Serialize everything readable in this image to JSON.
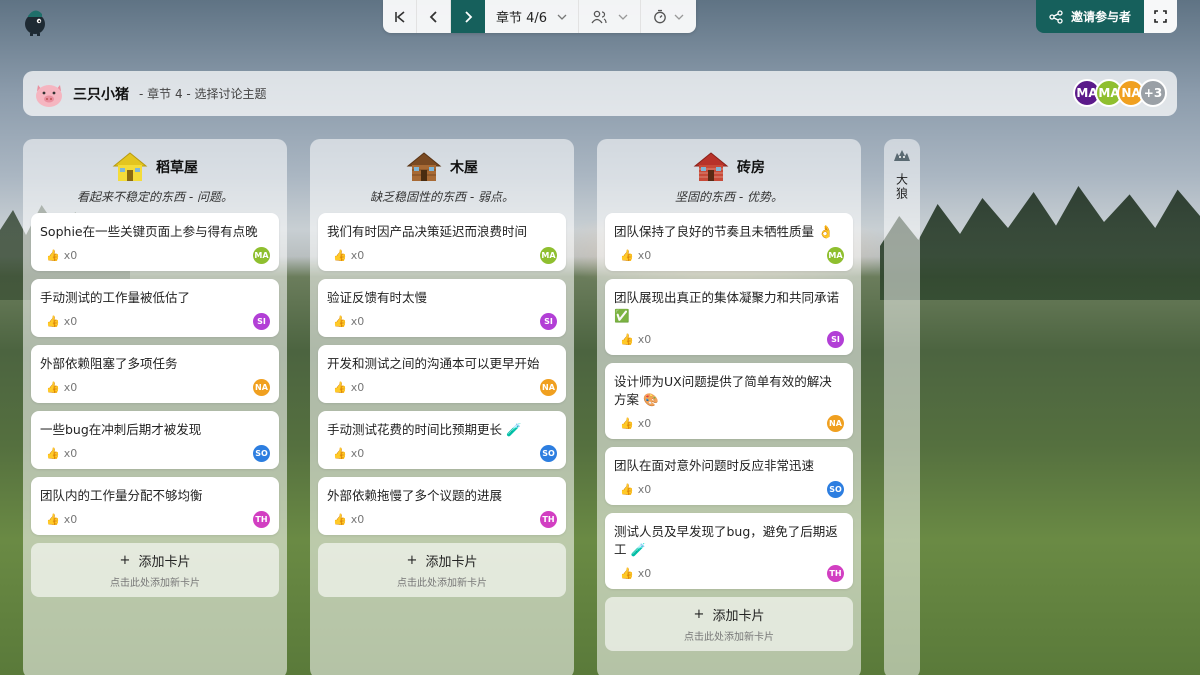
{
  "colors": {
    "accent": "#16605c",
    "avatar_MA1": "#5b1a8a",
    "avatar_MA2": "#8fbf2f",
    "avatar_NA": "#f0a020",
    "avatar_more": "#9aa0a6",
    "card_MA": "#8fbf2f",
    "card_SI": "#b23fd6",
    "card_NA": "#f0a020",
    "card_SO": "#2d7ee0",
    "card_TH": "#d23fc2"
  },
  "toolbar": {
    "first_icon": "skip-first-icon",
    "prev_icon": "chevron-left-icon",
    "next_icon": "chevron-right-icon",
    "chapter_label": "章节 4/6",
    "users_icon": "users-icon",
    "timer_icon": "timer-icon"
  },
  "invite": {
    "label": "邀请参与者",
    "icon": "share-icon"
  },
  "fullscreen": {
    "icon": "fullscreen-icon"
  },
  "header": {
    "title": "三只小猪",
    "subtitle": "- 章节 4 - 选择讨论主题",
    "avatars": [
      {
        "initials": "MA",
        "color": "#5b1a8a"
      },
      {
        "initials": "MA",
        "color": "#8fbf2f"
      },
      {
        "initials": "NA",
        "color": "#f0a020"
      },
      {
        "initials": "+3",
        "color": "#9aa0a6"
      }
    ]
  },
  "columns": [
    {
      "title": "稻草屋",
      "desc": "看起来不稳定的东西 - 问题。",
      "icon": "straw-house-icon",
      "cards": [
        {
          "text": "Sophie在一些关键页面上参与得有点晚",
          "likes": "x0",
          "avatar": "MA"
        },
        {
          "text": "手动测试的工作量被低估了",
          "likes": "x0",
          "avatar": "SI"
        },
        {
          "text": "外部依赖阻塞了多项任务",
          "likes": "x0",
          "avatar": "NA"
        },
        {
          "text": "一些bug在冲刺后期才被发现",
          "likes": "x0",
          "avatar": "SO"
        },
        {
          "text": "团队内的工作量分配不够均衡",
          "likes": "x0",
          "avatar": "TH"
        }
      ],
      "add_label": "添加卡片",
      "add_hint": "点击此处添加新卡片"
    },
    {
      "title": "木屋",
      "desc": "缺乏稳固性的东西 - 弱点。",
      "icon": "wood-house-icon",
      "cards": [
        {
          "text": "我们有时因产品决策延迟而浪费时间",
          "likes": "x0",
          "avatar": "MA"
        },
        {
          "text": "验证反馈有时太慢",
          "likes": "x0",
          "avatar": "SI"
        },
        {
          "text": "开发和测试之间的沟通本可以更早开始",
          "likes": "x0",
          "avatar": "NA"
        },
        {
          "text": "手动测试花费的时间比预期更长 🧪",
          "likes": "x0",
          "avatar": "SO"
        },
        {
          "text": "外部依赖拖慢了多个议题的进展",
          "likes": "x0",
          "avatar": "TH"
        }
      ],
      "add_label": "添加卡片",
      "add_hint": "点击此处添加新卡片"
    },
    {
      "title": "砖房",
      "desc": "坚固的东西 - 优势。",
      "icon": "brick-house-icon",
      "cards": [
        {
          "text": "团队保持了良好的节奏且未牺牲质量 👌",
          "likes": "x0",
          "avatar": "MA"
        },
        {
          "text": "团队展现出真正的集体凝聚力和共同承诺 ✅",
          "likes": "x0",
          "avatar": "SI"
        },
        {
          "text": "设计师为UX问题提供了简单有效的解决方案 🎨",
          "likes": "x0",
          "avatar": "NA"
        },
        {
          "text": "团队在面对意外问题时反应非常迅速",
          "likes": "x0",
          "avatar": "SO"
        },
        {
          "text": "测试人员及早发现了bug，避免了后期返工 🧪",
          "likes": "x0",
          "avatar": "TH"
        }
      ],
      "add_label": "添加卡片",
      "add_hint": "点击此处添加新卡片"
    }
  ],
  "side_column": {
    "label": "大狼",
    "icon": "wolf-icon"
  }
}
